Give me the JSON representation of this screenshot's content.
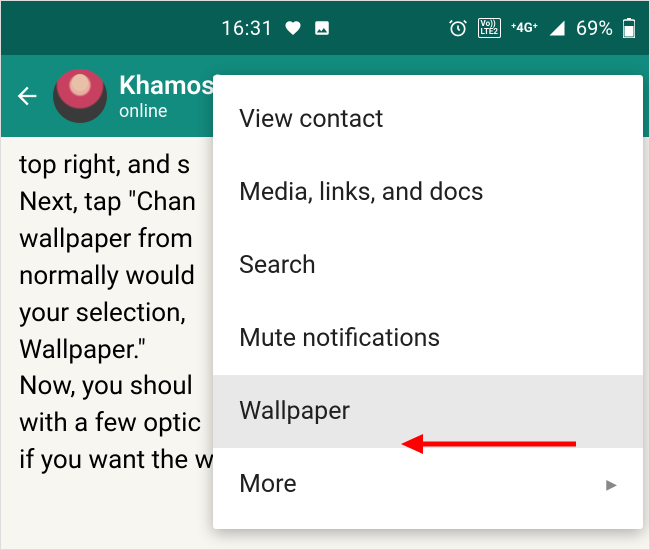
{
  "status_bar": {
    "time": "16:31",
    "battery_percent": "69%"
  },
  "chat_header": {
    "contact_name": "Khamosh",
    "status": "online"
  },
  "chat_body": {
    "line1": "top right, and s",
    "line2": "Next, tap \"Chan",
    "line3": "wallpaper from",
    "line4": "normally would",
    "line5": "your selection,",
    "line6": "Wallpaper.\"",
    "line7": "",
    "line8": "Now, you shoul",
    "line9": "with a few optic",
    "line10": "if you want the wallpaper to be just"
  },
  "menu": {
    "items": {
      "0": {
        "label": "View contact"
      },
      "1": {
        "label": "Media, links, and docs"
      },
      "2": {
        "label": "Search"
      },
      "3": {
        "label": "Mute notifications"
      },
      "4": {
        "label": "Wallpaper"
      },
      "5": {
        "label": "More"
      }
    },
    "highlighted_index": 4
  },
  "annotation": {
    "target": "wallpaper-menu-item"
  }
}
